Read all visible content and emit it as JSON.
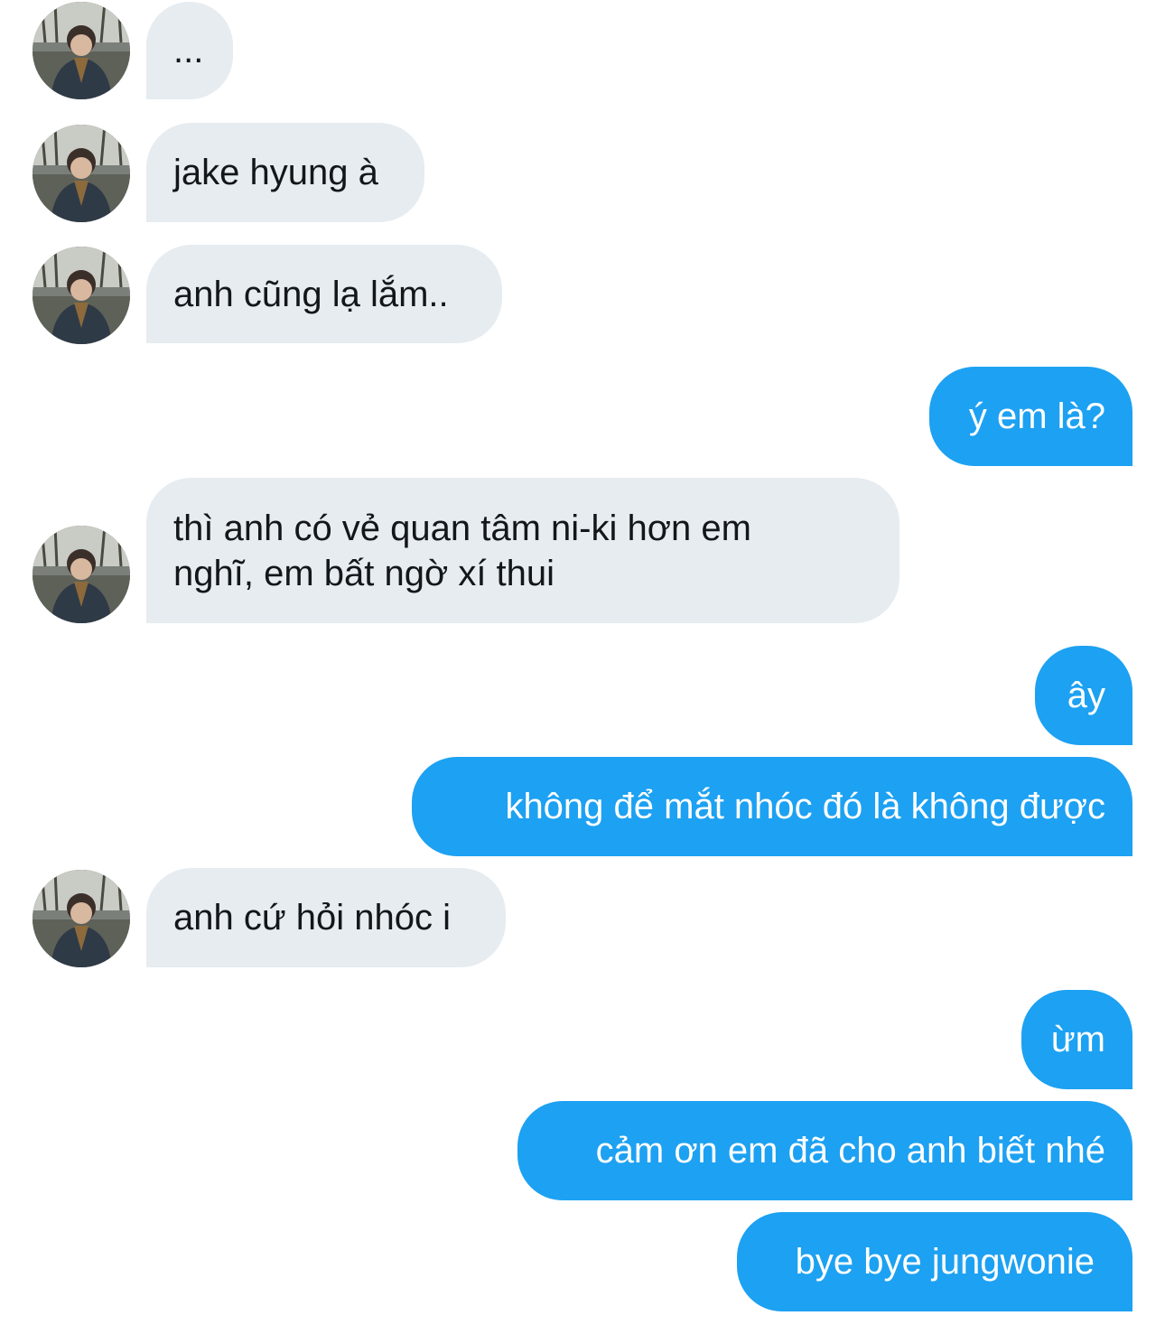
{
  "conversation": {
    "messages": [
      {
        "direction": "incoming",
        "text": "...",
        "has_avatar": true
      },
      {
        "direction": "incoming",
        "text": "jake hyung à",
        "has_avatar": true
      },
      {
        "direction": "incoming",
        "text": "anh cũng lạ lắm..",
        "has_avatar": true
      },
      {
        "direction": "outgoing",
        "text": "ý em là?"
      },
      {
        "direction": "incoming",
        "text": "thì anh có vẻ quan tâm ni-ki hơn em nghĩ, em bất ngờ xí thui",
        "has_avatar": true
      },
      {
        "direction": "outgoing",
        "text": "ây"
      },
      {
        "direction": "outgoing",
        "text": "không để mắt nhóc đó là không được"
      },
      {
        "direction": "incoming",
        "text": "anh cứ hỏi nhóc i",
        "has_avatar": true
      },
      {
        "direction": "outgoing",
        "text": "ừm"
      },
      {
        "direction": "outgoing",
        "text": "cảm ơn em đã cho anh biết nhé"
      },
      {
        "direction": "outgoing",
        "text": "bye bye jungwonie"
      }
    ]
  },
  "colors": {
    "incoming_bubble": "#e6ecf0",
    "incoming_text": "#14171a",
    "outgoing_bubble": "#1da1f2",
    "outgoing_text": "#ffffff",
    "background": "#ffffff"
  },
  "icons": {
    "avatar": "profile-photo"
  }
}
